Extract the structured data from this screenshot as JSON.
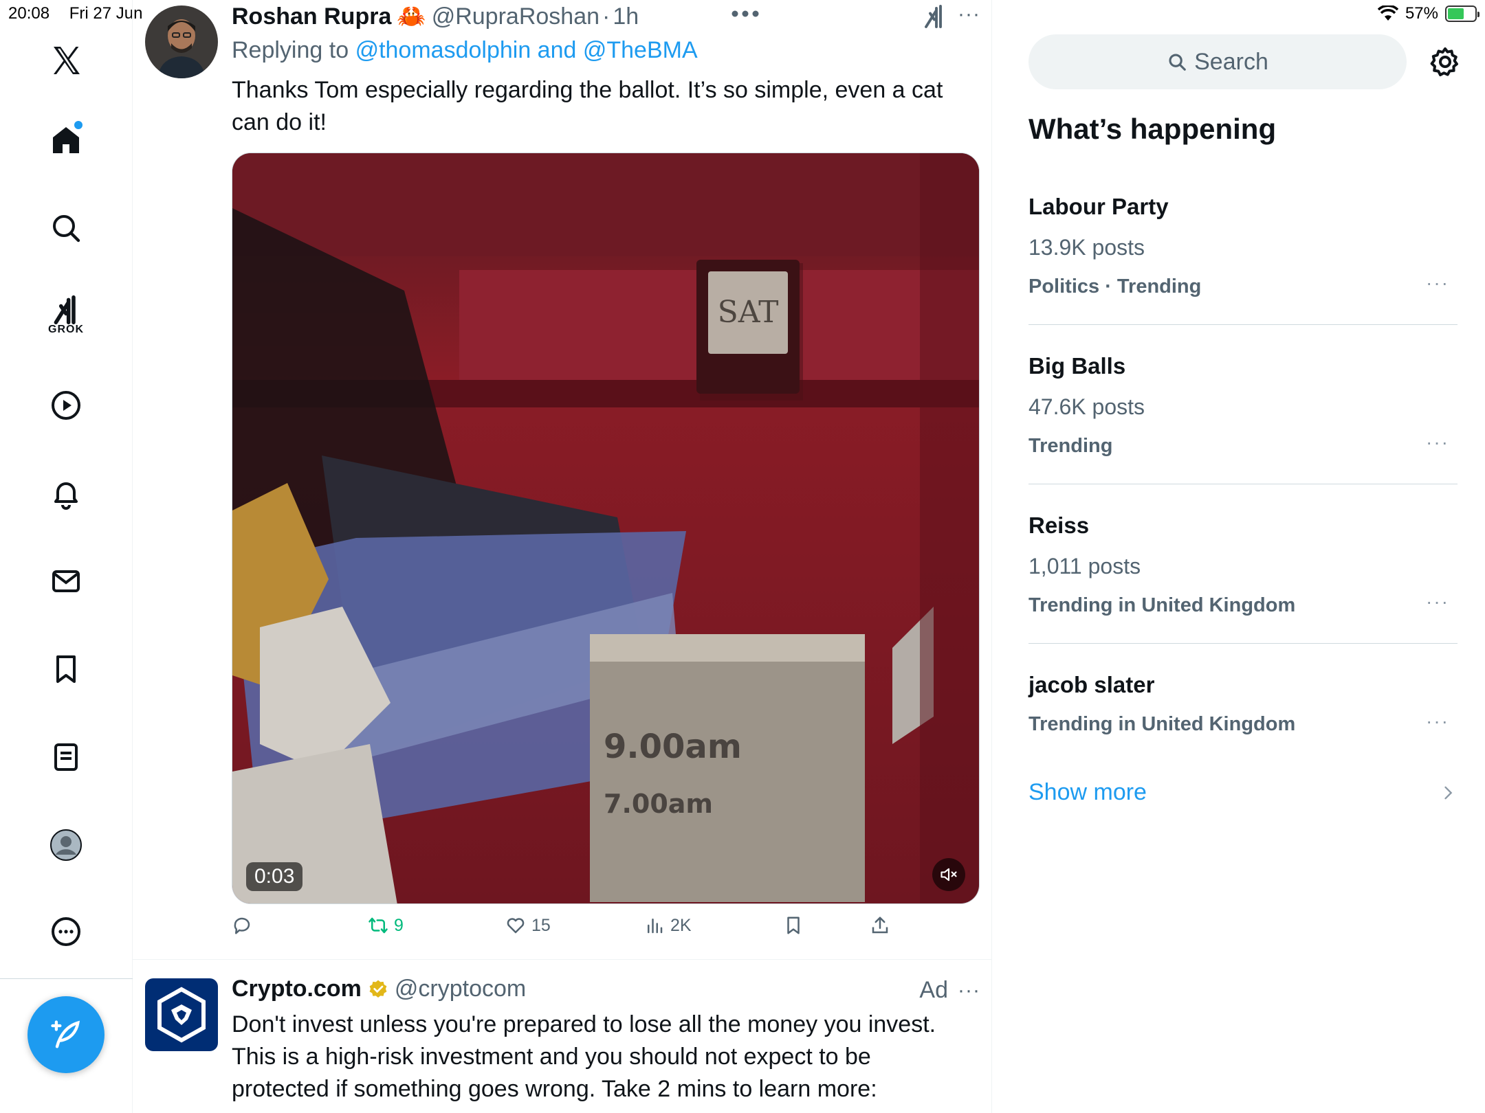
{
  "status_bar": {
    "time": "20:08",
    "date": "Fri 27 Jun",
    "battery": "57%"
  },
  "nav": {
    "grok_label": "GROK"
  },
  "tweet": {
    "name": "Roshan Rupra",
    "emoji": "🦀",
    "handle": "@RupraRoshan",
    "separator": "·",
    "time": "1h",
    "replying_prefix": "Replying to",
    "replying_to": "@thomasdolphin and @TheBMA",
    "text": "Thanks Tom especially regarding the ballot. It’s so simple, even a cat can do it!",
    "video": {
      "duration": "0:03",
      "sign_label": "SAT",
      "time_1": "9.00am",
      "time_2": "7.00am"
    },
    "actions": {
      "retweets": "9",
      "likes": "15",
      "views": "2K"
    }
  },
  "ad_tweet": {
    "name": "Crypto.com",
    "handle": "@cryptocom",
    "ad_label": "Ad",
    "text": "Don't invest unless you're prepared to lose all the money you invest. This is a high-risk investment and you should not expect to be protected if something goes wrong. Take 2 mins to learn more:"
  },
  "search": {
    "placeholder": "Search"
  },
  "whats_happening": {
    "title": "What’s happening",
    "trends": [
      {
        "title": "Labour Party",
        "posts": "13.9K posts",
        "context": "Politics · Trending"
      },
      {
        "title": "Big Balls",
        "posts": "47.6K posts",
        "context": "Trending"
      },
      {
        "title": "Reiss",
        "posts": "1,011 posts",
        "context": "Trending in United Kingdom"
      },
      {
        "title": "jacob slater",
        "posts": "",
        "context": "Trending in United Kingdom"
      }
    ],
    "show_more": "Show more"
  },
  "colors": {
    "accent": "#1d9bf0",
    "retweet_green": "#00ba7c",
    "text_primary": "#0f1419",
    "text_secondary": "#536471"
  }
}
